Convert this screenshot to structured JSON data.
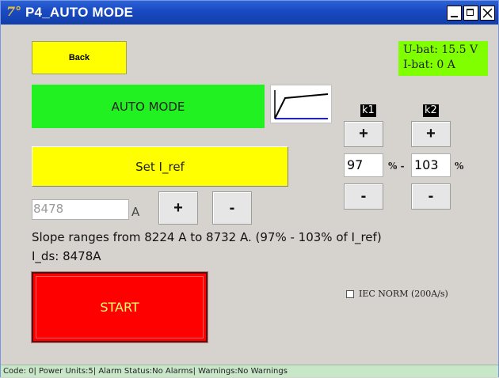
{
  "window": {
    "title": "P4_AUTO MODE",
    "app_icon": "app-logo-icon",
    "controls": [
      "minimize-icon",
      "maximize-icon",
      "close-icon"
    ]
  },
  "back_button": {
    "label": "Back"
  },
  "battery": {
    "voltage": "U-bat: 15.5 V",
    "current": "I-bat: 0 A"
  },
  "mode": {
    "label": "AUTO MODE",
    "curve_icon": "ramp-curve-icon"
  },
  "set_iref_button": {
    "label": "Set I_ref"
  },
  "iref": {
    "value": "8478",
    "unit": "A",
    "plus_label": "+",
    "minus_label": "-"
  },
  "k1": {
    "label": "k1",
    "value": "97",
    "unit": "% -",
    "plus_label": "+",
    "minus_label": "-"
  },
  "k2": {
    "label": "k2",
    "value": "103",
    "unit": "%",
    "plus_label": "+",
    "minus_label": "-"
  },
  "info": {
    "slope": "Slope ranges from 8224 A to 8732 A. (97% - 103% of I_ref)",
    "ids": "I_ds: 8478A"
  },
  "start_button": {
    "label": "START"
  },
  "iec_norm": {
    "label": "IEC NORM (200A/s)",
    "checked": false
  },
  "status_bar": {
    "text": "Code: 0| Power Units:5| Alarm Status:No Alarms| Warnings:No Warnings"
  },
  "colors": {
    "titlebar": "#1a4bc4",
    "yellow": "#ffff00",
    "green": "#21f021",
    "lime": "#80ff00",
    "red": "#ff0000"
  }
}
